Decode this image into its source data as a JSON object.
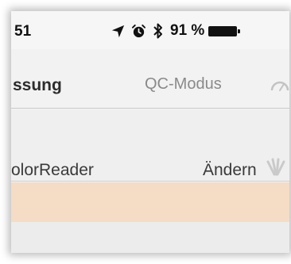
{
  "status_bar": {
    "time": "51",
    "icons": [
      "location-arrow-icon",
      "alarm-clock-icon",
      "bluetooth-icon",
      "battery-icon"
    ],
    "battery_percent": "91 %",
    "battery_level": 0.91
  },
  "nav": {
    "left_tab": "ssung",
    "right_tab": "QC-Modus",
    "right_icon": "gauge-icon"
  },
  "device": {
    "name": "olorReader",
    "change_label": "Ändern",
    "signal_icon": "signal-strength-icon"
  },
  "colors": {
    "band": "#f4dcc5",
    "text": "#3a3a3a",
    "muted": "#8a8a8a"
  }
}
